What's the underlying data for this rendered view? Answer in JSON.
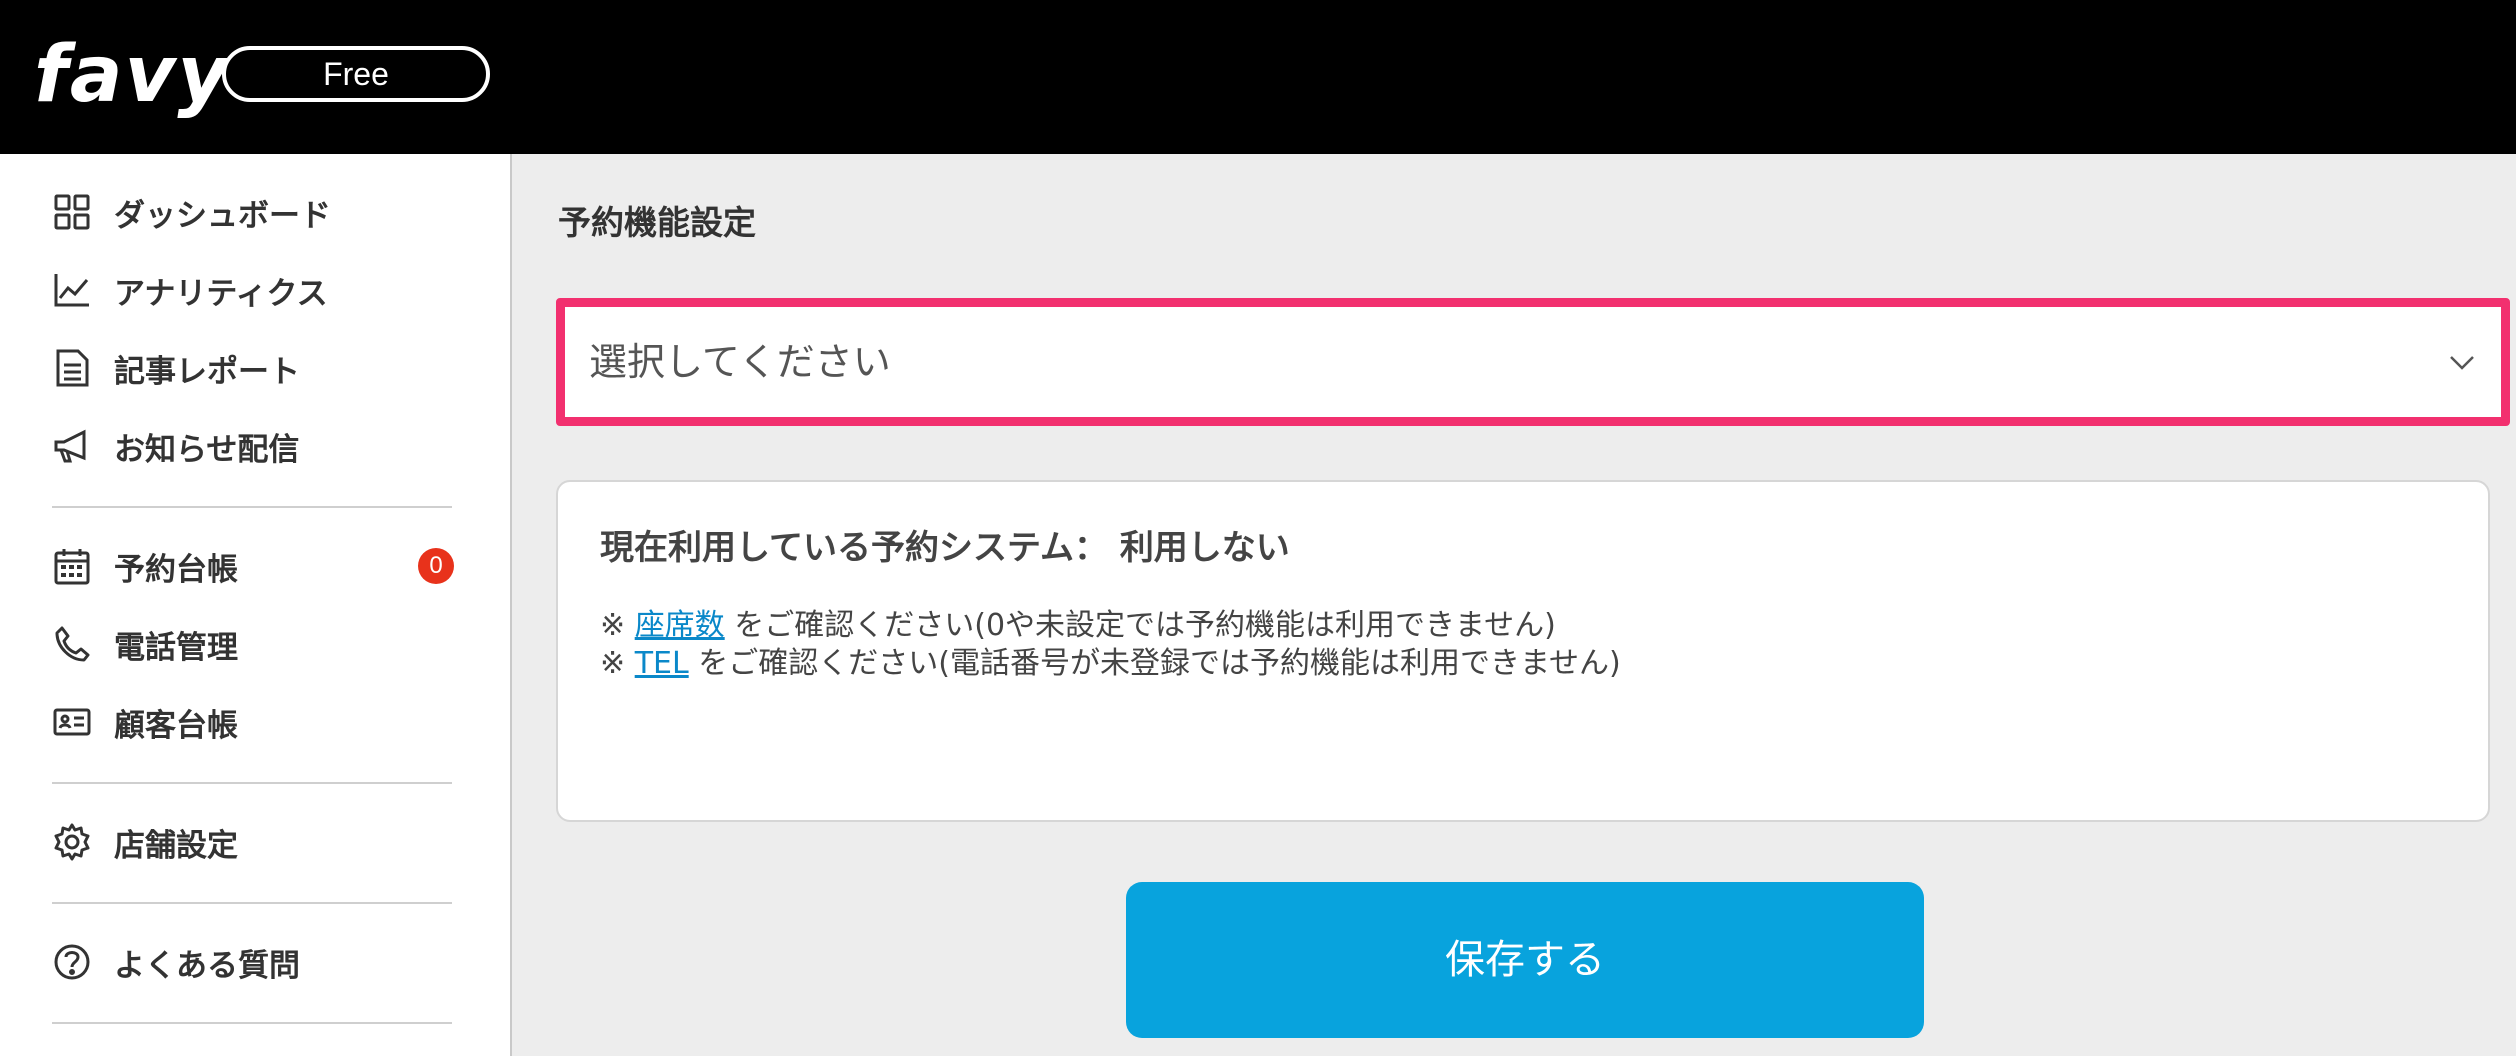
{
  "header": {
    "logo": "favy",
    "plan": "Free"
  },
  "sidebar": {
    "items": [
      {
        "label": "ダッシュボード",
        "icon": "grid-icon"
      },
      {
        "label": "アナリティクス",
        "icon": "chart-line-icon"
      },
      {
        "label": "記事レポート",
        "icon": "document-icon"
      },
      {
        "label": "お知らせ配信",
        "icon": "megaphone-icon"
      },
      {
        "label": "予約台帳",
        "icon": "calendar-icon",
        "badge": "0"
      },
      {
        "label": "電話管理",
        "icon": "phone-icon"
      },
      {
        "label": "顧客台帳",
        "icon": "id-card-icon"
      },
      {
        "label": "店舗設定",
        "icon": "gear-icon"
      },
      {
        "label": "よくある質問",
        "icon": "help-circle-icon"
      }
    ]
  },
  "main": {
    "title": "予約機能設定",
    "select": {
      "placeholder": "選択してください"
    },
    "info": {
      "current_label": "現在利用している予約システム：",
      "current_value": "利用しない",
      "note1_prefix": "※",
      "note1_link": "座席数",
      "note1_suffix": "をご確認ください(0や未設定では予約機能は利用できません)",
      "note2_prefix": "※",
      "note2_link": "TEL",
      "note2_suffix": "をご確認ください(電話番号が未登録では予約機能は利用できません)"
    },
    "save_label": "保存する"
  },
  "colors": {
    "header_bg": "#000000",
    "highlight_border": "#f2306f",
    "primary_button": "#08a3dd",
    "link": "#0a88c9",
    "badge": "#e8321b"
  }
}
